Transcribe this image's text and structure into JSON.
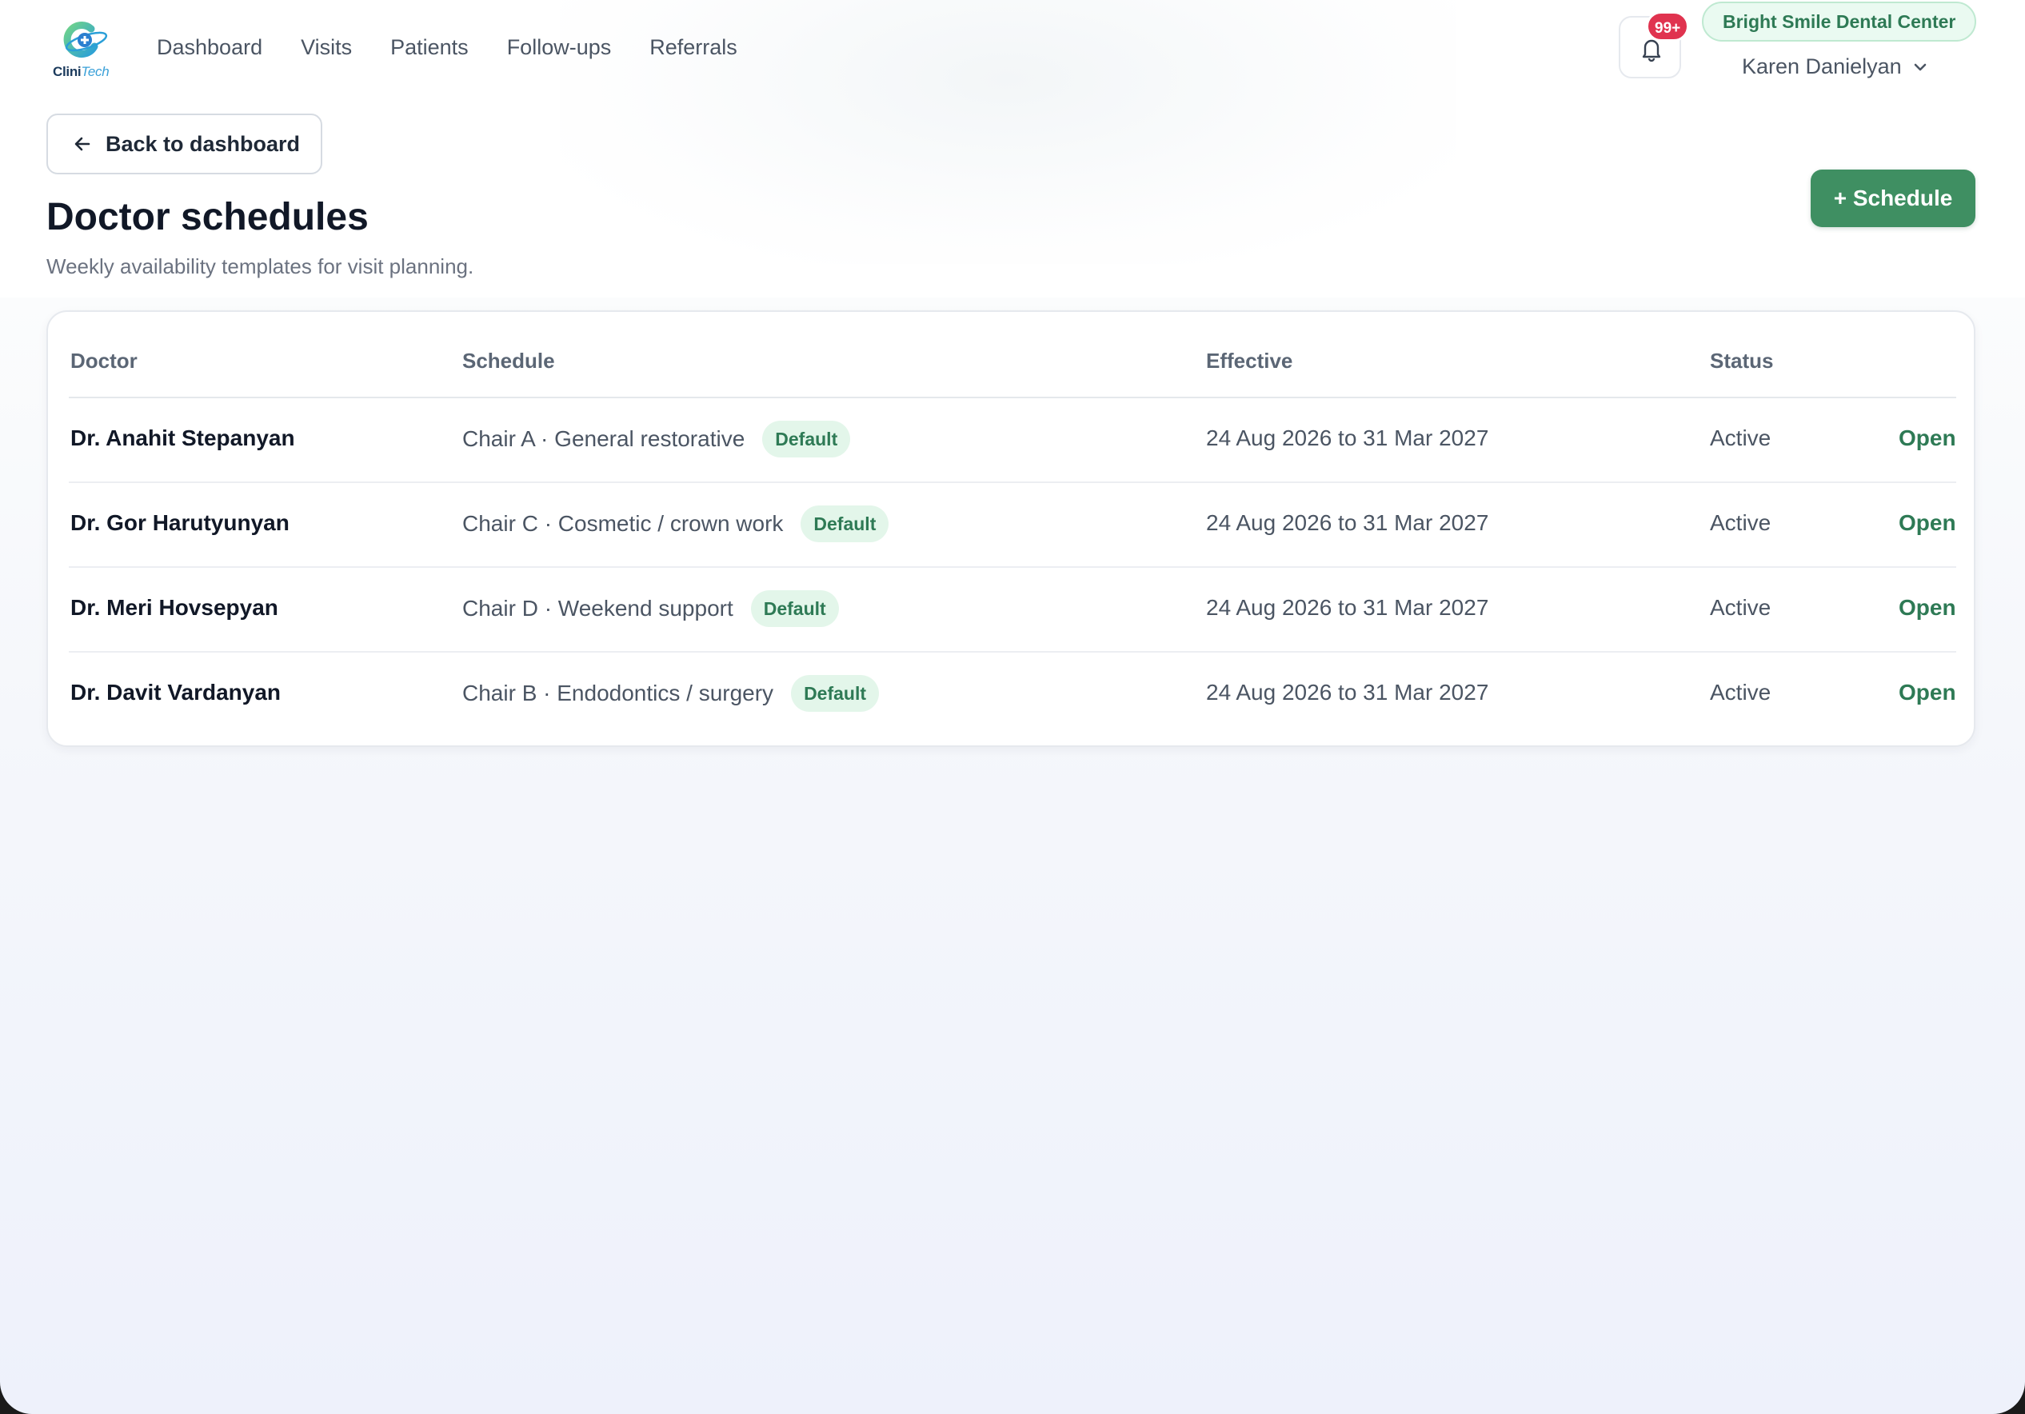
{
  "brand": {
    "name_main": "Clini",
    "name_accent": "Tech"
  },
  "nav": {
    "items": [
      "Dashboard",
      "Visits",
      "Patients",
      "Follow-ups",
      "Referrals"
    ]
  },
  "header": {
    "notification_count": "99+",
    "clinic_name": "Bright Smile Dental Center",
    "user_name": "Karen Danielyan"
  },
  "page": {
    "back_label": "Back to dashboard",
    "title": "Doctor schedules",
    "subtitle": "Weekly availability templates for visit planning.",
    "add_label": "+ Schedule"
  },
  "table": {
    "columns": [
      "Doctor",
      "Schedule",
      "Effective",
      "Status"
    ],
    "rows": [
      {
        "doctor": "Dr. Anahit Stepanyan",
        "schedule": "Chair A · General restorative",
        "tag": "Default",
        "effective": "24 Aug 2026 to 31 Mar 2027",
        "status": "Active",
        "action": "Open"
      },
      {
        "doctor": "Dr. Gor Harutyunyan",
        "schedule": "Chair C · Cosmetic / crown work",
        "tag": "Default",
        "effective": "24 Aug 2026 to 31 Mar 2027",
        "status": "Active",
        "action": "Open"
      },
      {
        "doctor": "Dr. Meri Hovsepyan",
        "schedule": "Chair D · Weekend support",
        "tag": "Default",
        "effective": "24 Aug 2026 to 31 Mar 2027",
        "status": "Active",
        "action": "Open"
      },
      {
        "doctor": "Dr. Davit Vardanyan",
        "schedule": "Chair B · Endodontics / surgery",
        "tag": "Default",
        "effective": "24 Aug 2026 to 31 Mar 2027",
        "status": "Active",
        "action": "Open"
      }
    ]
  },
  "colors": {
    "primary": "#3f8f62",
    "tag_bg": "#e3f6ea",
    "tag_text": "#2e7a55",
    "badge": "#e0334f"
  },
  "icons": [
    "clinitech-logo",
    "bell-icon",
    "chevron-down-icon",
    "arrow-left-icon"
  ]
}
